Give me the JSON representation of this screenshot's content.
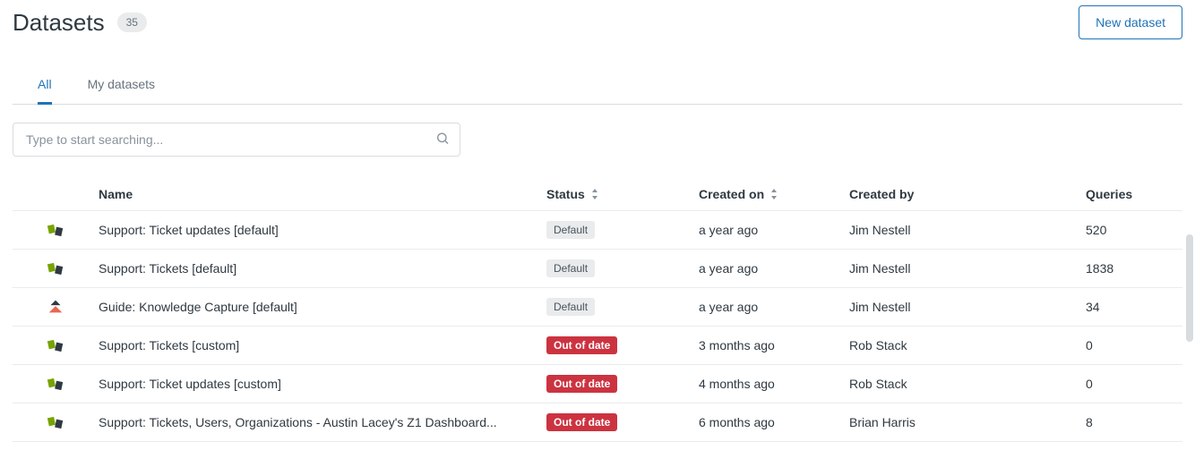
{
  "header": {
    "title": "Datasets",
    "count": "35",
    "newButton": "New dataset"
  },
  "tabs": [
    {
      "label": "All",
      "active": true
    },
    {
      "label": "My datasets",
      "active": false
    }
  ],
  "search": {
    "placeholder": "Type to start searching..."
  },
  "table": {
    "columns": {
      "name": "Name",
      "status": "Status",
      "createdOn": "Created on",
      "createdBy": "Created by",
      "queries": "Queries"
    },
    "rows": [
      {
        "iconType": "support",
        "name": "Support: Ticket updates [default]",
        "statusLabel": "Default",
        "statusKind": "default",
        "createdOn": "a year ago",
        "createdBy": "Jim Nestell",
        "queries": "520"
      },
      {
        "iconType": "support",
        "name": "Support: Tickets [default]",
        "statusLabel": "Default",
        "statusKind": "default",
        "createdOn": "a year ago",
        "createdBy": "Jim Nestell",
        "queries": "1838"
      },
      {
        "iconType": "guide",
        "name": "Guide: Knowledge Capture [default]",
        "statusLabel": "Default",
        "statusKind": "default",
        "createdOn": "a year ago",
        "createdBy": "Jim Nestell",
        "queries": "34"
      },
      {
        "iconType": "support",
        "name": "Support: Tickets [custom]",
        "statusLabel": "Out of date",
        "statusKind": "outofdate",
        "createdOn": "3 months ago",
        "createdBy": "Rob Stack",
        "queries": "0"
      },
      {
        "iconType": "support",
        "name": "Support: Ticket updates [custom]",
        "statusLabel": "Out of date",
        "statusKind": "outofdate",
        "createdOn": "4 months ago",
        "createdBy": "Rob Stack",
        "queries": "0"
      },
      {
        "iconType": "support",
        "name": "Support: Tickets, Users, Organizations - Austin Lacey's Z1 Dashboard...",
        "statusLabel": "Out of date",
        "statusKind": "outofdate",
        "createdOn": "6 months ago",
        "createdBy": "Brian Harris",
        "queries": "8"
      }
    ]
  }
}
